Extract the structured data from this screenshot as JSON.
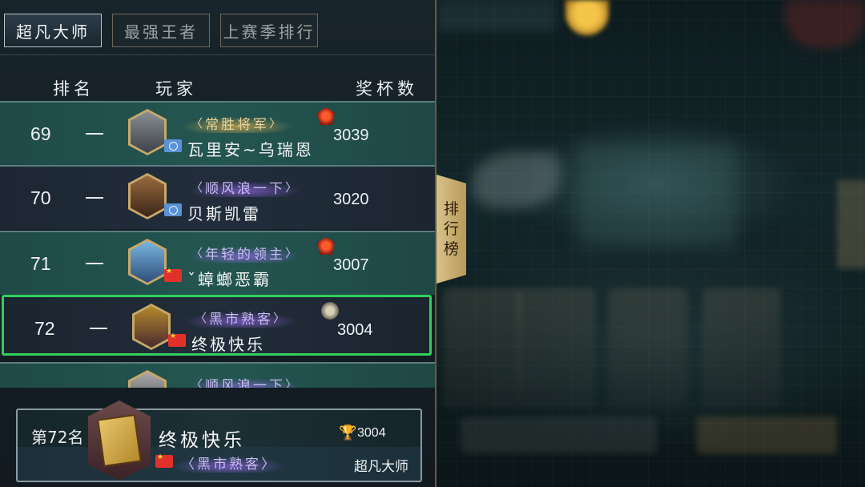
{
  "tabs": [
    {
      "label": "超凡大师",
      "active": true
    },
    {
      "label": "最强王者",
      "active": false
    },
    {
      "label": "上赛季排行",
      "active": false
    }
  ],
  "columns": {
    "rank": "排名",
    "player": "玩家",
    "trophies": "奖杯数"
  },
  "rows": [
    {
      "rank": "69",
      "trend": "—",
      "title": "常胜将军",
      "name": "瓦里安~乌瑞恩",
      "trophies": "3039",
      "flag": "un",
      "badge": "red",
      "style": "teal",
      "title_style": "gold"
    },
    {
      "rank": "70",
      "trend": "—",
      "title": "顺风浪一下",
      "name": "贝斯凯雷",
      "trophies": "3020",
      "flag": "un",
      "badge": "none",
      "style": "dark",
      "title_style": "purple"
    },
    {
      "rank": "71",
      "trend": "—",
      "title": "年轻的领主",
      "name": "ˇ蟑螂恶霸",
      "trophies": "3007",
      "flag": "cn",
      "badge": "red",
      "style": "teal",
      "title_style": "purple"
    },
    {
      "rank": "72",
      "trend": "—",
      "title": "黑市熟客",
      "name": "终极快乐",
      "trophies": "3004",
      "flag": "cn",
      "badge": "grey",
      "style": "sel",
      "title_style": "purple"
    },
    {
      "rank": "",
      "trend": "",
      "title": "顺风浪一下",
      "name": "",
      "trophies": "",
      "flag": "none",
      "badge": "none",
      "style": "teal",
      "title_style": "purple"
    }
  ],
  "self": {
    "rank_label": "第72名",
    "name": "终极快乐",
    "trophies": "3004",
    "title": "黑市熟客",
    "tier": "超凡大师",
    "flag": "cn"
  },
  "side_tab": {
    "label_chars": [
      "排",
      "行",
      "榜"
    ]
  },
  "colors": {
    "selected_border": "#31d05a",
    "teal_row": "#245651",
    "dark_row": "#222d3c",
    "side_tab": "#d8c18a"
  }
}
